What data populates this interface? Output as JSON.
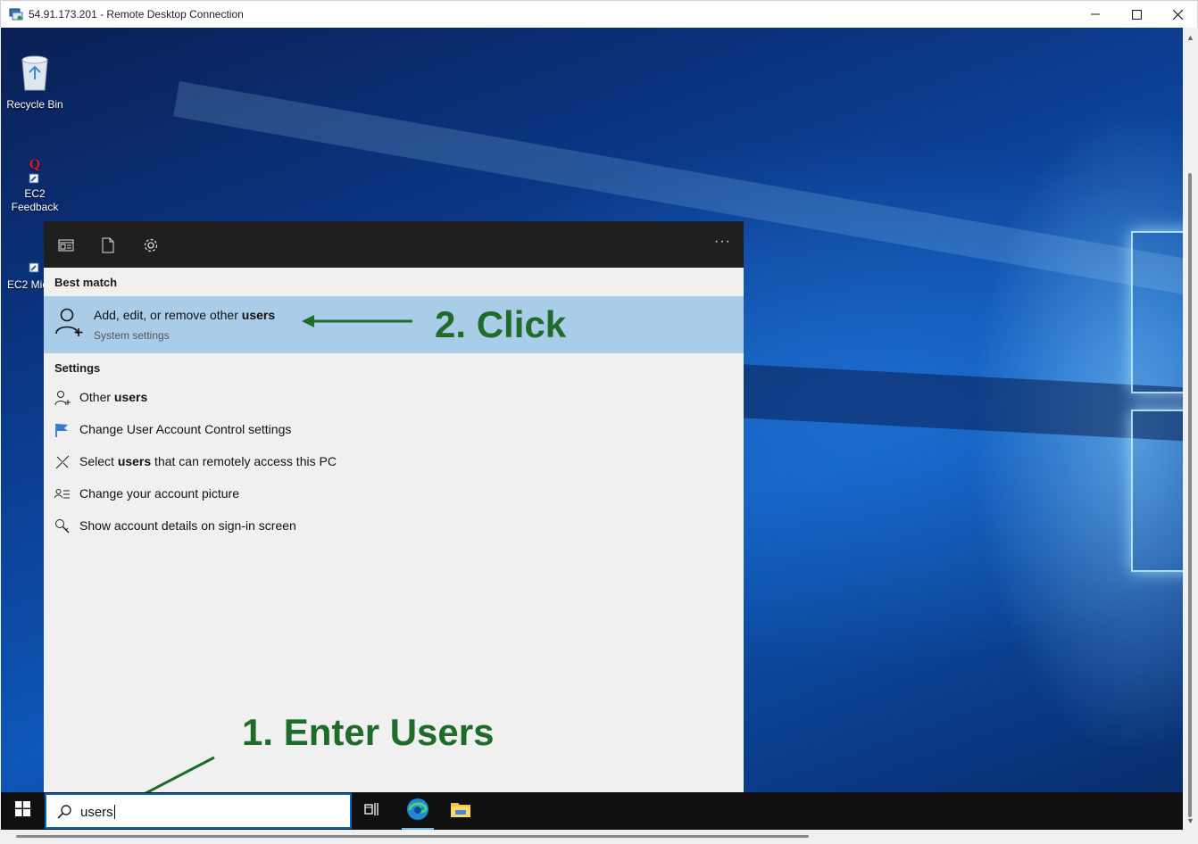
{
  "window": {
    "title": "54.91.173.201 - Remote Desktop Connection",
    "controls": [
      "minimize",
      "maximize",
      "close"
    ]
  },
  "desktop": {
    "icons": [
      {
        "label": "Recycle Bin",
        "icon": "recycle-bin-icon"
      },
      {
        "label": "EC2 Feedback",
        "icon": "ec2-feedback-icon"
      },
      {
        "label": "EC2 Micros",
        "icon": "ec2-microsoft-icon"
      }
    ]
  },
  "search_panel": {
    "header_icons": [
      "apps-icon",
      "documents-icon",
      "settings-icon",
      "more-icon"
    ],
    "best_match": {
      "heading": "Best match",
      "title_prefix": "Add, edit, or remove other ",
      "title_bold": "users",
      "subtitle": "System settings"
    },
    "settings": {
      "heading": "Settings",
      "items": [
        {
          "pre": "Other ",
          "bold": "users",
          "post": "",
          "icon": "person-add-icon"
        },
        {
          "pre": "Change User Account Control settings",
          "bold": "",
          "post": "",
          "icon": "flag-icon"
        },
        {
          "pre": "Select ",
          "bold": "users",
          "post": " that can remotely access this PC",
          "icon": "remote-icon"
        },
        {
          "pre": "Change your account picture",
          "bold": "",
          "post": "",
          "icon": "account-picture-icon"
        },
        {
          "pre": "Show account details on sign-in screen",
          "bold": "",
          "post": "",
          "icon": "key-search-icon"
        }
      ]
    }
  },
  "annotations": {
    "step1": "1. Enter Users",
    "step2": "2. Click",
    "color": "#1e6b2a"
  },
  "taskbar": {
    "search_value": "users",
    "apps": [
      "task-view-icon",
      "edge-icon",
      "file-explorer-icon"
    ]
  },
  "colors": {
    "best_match_bg": "#a9cce9",
    "panel_header_bg": "#1f1f1f",
    "panel_bg": "#f0f0f0",
    "taskbar_bg": "#101010",
    "search_border": "#0067c0"
  }
}
